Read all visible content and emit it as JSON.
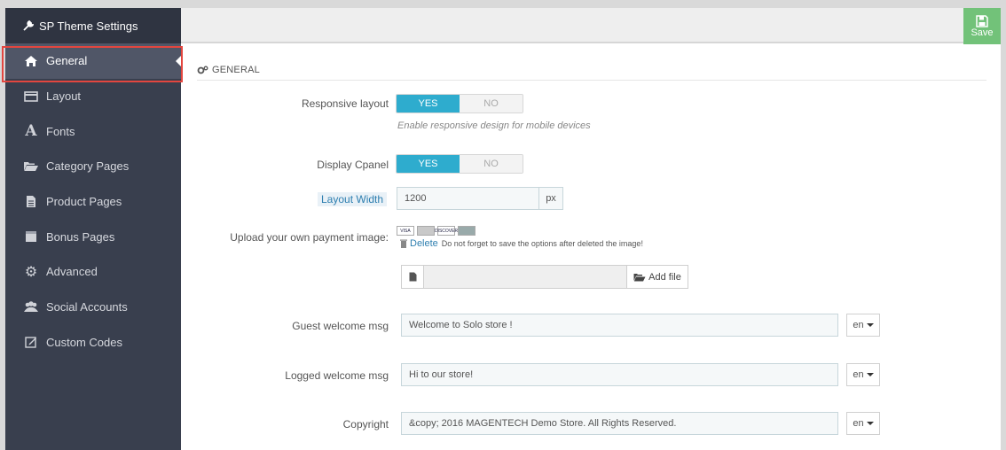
{
  "sidebar": {
    "title": "SP Theme Settings",
    "items": [
      {
        "label": "General",
        "icon": "home-icon"
      },
      {
        "label": "Layout",
        "icon": "layout-icon"
      },
      {
        "label": "Fonts",
        "icon": "font-icon"
      },
      {
        "label": "Category Pages",
        "icon": "folder-open-icon"
      },
      {
        "label": "Product Pages",
        "icon": "file-icon"
      },
      {
        "label": "Bonus Pages",
        "icon": "bonus-icon"
      },
      {
        "label": "Advanced",
        "icon": "gear-icon"
      },
      {
        "label": "Social Accounts",
        "icon": "users-icon"
      },
      {
        "label": "Custom Codes",
        "icon": "edit-icon"
      }
    ]
  },
  "toolbar": {
    "save_label": "Save"
  },
  "panel": {
    "heading": "GENERAL"
  },
  "fields": {
    "responsive": {
      "label": "Responsive layout",
      "yes": "YES",
      "no": "NO",
      "help": "Enable responsive design for mobile devices"
    },
    "cpanel": {
      "label": "Display Cpanel",
      "yes": "YES",
      "no": "NO"
    },
    "width": {
      "label": "Layout Width",
      "value": "1200",
      "unit": "px"
    },
    "payment": {
      "label": "Upload your own payment image:",
      "cards": [
        "VISA",
        "",
        "DISCOVER",
        ""
      ],
      "delete_label": "Delete",
      "note": "Do not forget to save the options after deleted the image!",
      "add_file": "Add file"
    },
    "guest": {
      "label": "Guest welcome msg",
      "value": "Welcome to Solo store !",
      "lang": "en"
    },
    "logged": {
      "label": "Logged welcome msg",
      "value": "Hi to our store!",
      "lang": "en"
    },
    "copyright": {
      "label": "Copyright",
      "value": "&copy; 2016 MAGENTECH Demo Store. All Rights Reserved.",
      "lang": "en"
    }
  },
  "colors": {
    "accent": "#2eacce",
    "sidebar": "#393f4e",
    "save": "#72c279",
    "highlight": "#e3463f"
  }
}
